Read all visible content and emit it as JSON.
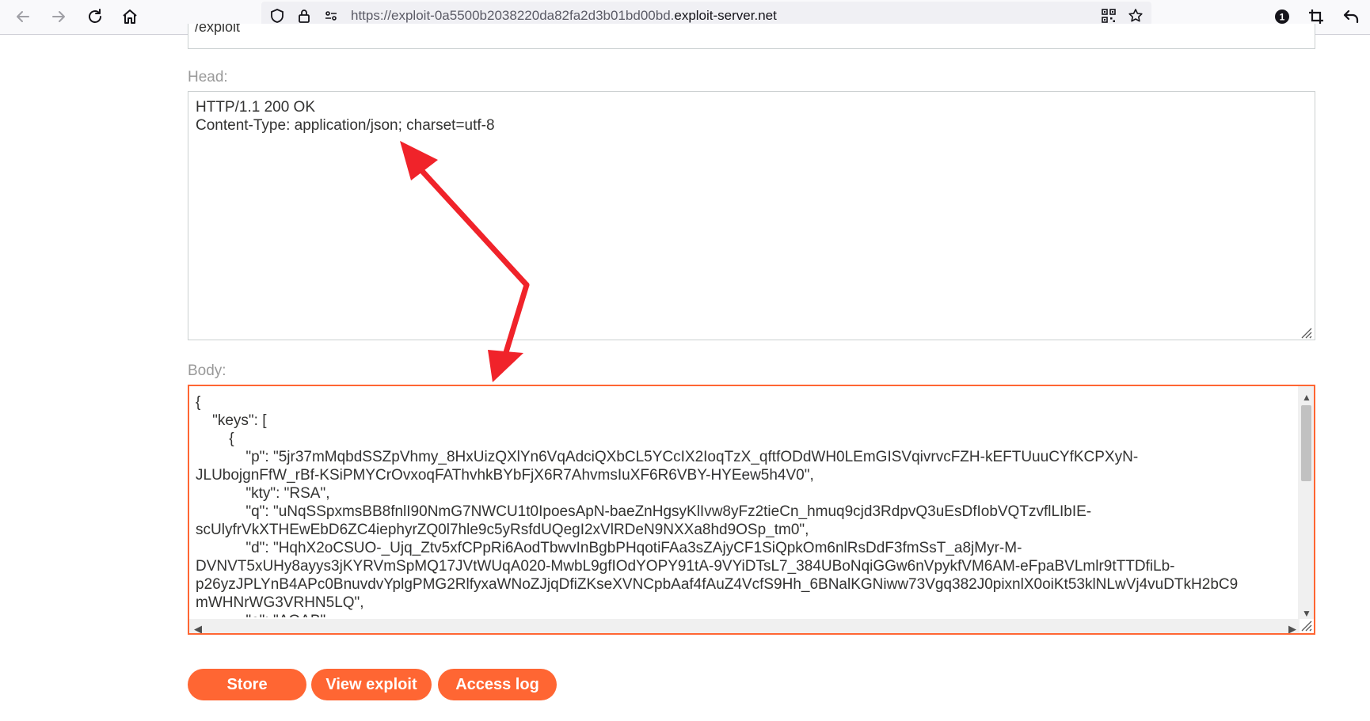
{
  "browser": {
    "url_prefix": "https://exploit-0a5500b2038220da82fa2d3b01bd00bd.",
    "url_domain": "exploit-server.net",
    "notification_count": "1",
    "icons": [
      "back-arrow-icon",
      "forward-arrow-icon",
      "reload-icon",
      "home-icon",
      "shield-icon",
      "lock-icon",
      "permissions-icon",
      "qr-code-icon",
      "star-icon",
      "extensions-icon",
      "crop-icon",
      "undo-icon"
    ]
  },
  "form": {
    "file_value": "/exploit",
    "head_label": "Head:",
    "head_value": "HTTP/1.1 200 OK\nContent-Type: application/json; charset=utf-8",
    "body_label": "Body:",
    "body_lines": [
      "{",
      "    \"keys\": [",
      "        {",
      "            \"p\": \"5jr37mMqbdSSZpVhmy_8HxUizQXlYn6VqAdciQXbCL5YCcIX2IoqTzX_qftfODdWH0LEmGISVqivrvcFZH-kEFTUuuCYfKCPXyN-",
      "JLUbojgnFfW_rBf-KSiPMYCrOvxoqFAThvhkBYbFjX6R7AhvmsIuXF6R6VBY-HYEew5h4V0\",",
      "            \"kty\": \"RSA\",",
      "            \"q\": \"uNqSSpxmsBB8fnlI90NmG7NWCU1t0IpoesApN-baeZnHgsyKlIvw8yFz2tieCn_hmuq9cjd3RdpvQ3uEsDfIobVQTzvflLIbIE-",
      "scUlyfrVkXTHEwEbD6ZC4iephyrZQ0l7hle9c5yRsfdUQegI2xVlRDeN9NXXa8hd9OSp_tm0\",",
      "            \"d\": \"HqhX2oCSUO-_Ujq_Ztv5xfCPpRi6AodTbwvInBgbPHqotiFAa3sZAjyCF1SiQpkOm6nlRsDdF3fmSsT_a8jMyr-M-",
      "DVNVT5xUHy8ayys3jKYRVmSpMQ17JVtWUqA020-MwbL9gfIOdYOPY91tA-9VYiDTsL7_384UBoNqiGGw6nVpykfVM6AM-eFpaBVLmlr9tTTDfiLb-",
      "p26yzJPLYnB4APc0BnuvdvYplgPMG2RlfyxaWNoZJjqDfiZKseXVNCpbAaf4fAuZ4VcfS9Hh_6BNalKGNiww73Vgq382J0pixnlX0oiKt53klNLwVj4vuDTkH2bC9",
      "mWHNrWG3VRHN5LQ\",",
      "            \"e\": \"AQAB\","
    ]
  },
  "buttons": {
    "store": "Store",
    "view_exploit": "View exploit",
    "access_log": "Access log"
  }
}
